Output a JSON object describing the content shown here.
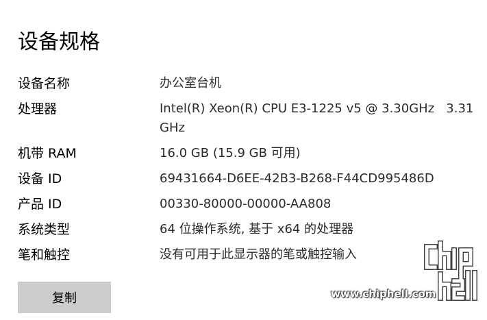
{
  "page": {
    "title": "设备规格"
  },
  "specs": [
    {
      "label": "设备名称",
      "value": "办公室台机"
    },
    {
      "label": "处理器",
      "value": "Intel(R) Xeon(R) CPU E3-1225 v5 @ 3.30GHz   3.31 GHz"
    },
    {
      "label": "机带 RAM",
      "value": "16.0 GB (15.9 GB 可用)"
    },
    {
      "label": "设备 ID",
      "value": "69431664-D6EE-42B3-B268-F44CD995486D"
    },
    {
      "label": "产品 ID",
      "value": "00330-80000-00000-AA808"
    },
    {
      "label": "系统类型",
      "value": "64 位操作系统, 基于 x64 的处理器"
    },
    {
      "label": "笔和触控",
      "value": "没有可用于此显示器的笔或触控输入"
    }
  ],
  "actions": {
    "copy_label": "复制"
  },
  "watermark": {
    "url": "www.chiphell.com",
    "logo_text": "chiphell"
  }
}
